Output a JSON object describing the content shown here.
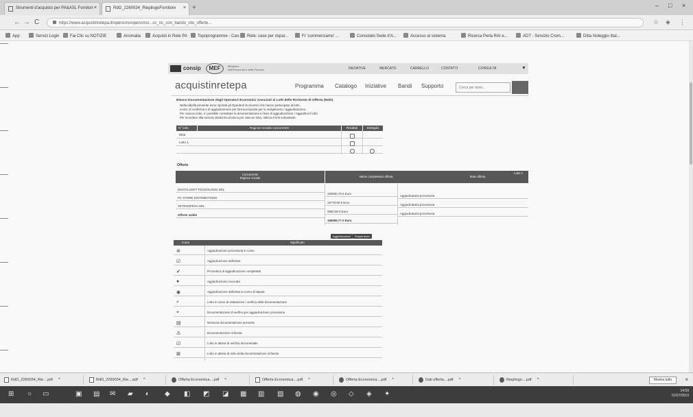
{
  "browser": {
    "tabs": [
      {
        "label": "Strumenti d'acquisto per PA&ASL Fornitori"
      },
      {
        "label": "RdO_2260034_RiepilogoFornitore"
      }
    ],
    "new_tab": "+",
    "window_controls": [
      "–",
      "□",
      "×"
    ],
    "nav": {
      "back": "←",
      "forward": "→",
      "reload": "C"
    },
    "url": "https://www.acquistinretepa.it/opencms/opencms/...cc_ric_con_bando_rdo_offerte...",
    "bookmarks": [
      "App",
      "Servizi Login",
      "Fai Clic su NOTIZIE",
      "Anomalia",
      "Acquisti in Rete PA",
      "Topoprogramme - Can...",
      "Rete: case per rispar...",
      "Fr 'commerciamo' ...",
      "Consolato Sede d'A...",
      "Accesso al sistema",
      "Ricerca Perla RAI e...",
      "ADT - Servizio Crom...",
      "Ditta Noleggio ittal..."
    ]
  },
  "site": {
    "consip": "consip",
    "mef": "MEF",
    "mef_subtitle": [
      "Ministero",
      "dell'Economia e delle Finanze"
    ],
    "topnav": [
      "INIZIATIVE",
      "MERCATO",
      "CARRELLO",
      "CONTATTI",
      "CONSULTA"
    ],
    "brand": "acquistinretepa",
    "mainnav": [
      "Programma",
      "Catalogo",
      "Iniziative",
      "Bandi",
      "Supporto"
    ],
    "search_placeholder": "Cerca per testo..."
  },
  "intro": {
    "title": "Elenco Documentazione degli Operatori Economici Associati ai Lotti delle Richieste di Offerta (RdO)",
    "lines": [
      "Nella tabella presente sono riportati gli Operatori Economici che hanno partecipato al lotto.",
      "Icona: di conferma e di aggiudicazione per forma proposta per lo svolgimento / aggiudicazione.",
      "Per ciascun lotto, e' possibile consultare la documentazione in fase di aggiudicazione / Aggiudica il lotto.",
      "Per accedere alla sezione Busta Economica per ciascun lotto, utilizza il link sottostante."
    ]
  },
  "table1": {
    "headers": [
      "N° lotto",
      "Ragione sociale concorrente",
      "Risultati",
      "Dettaglio"
    ],
    "rows": [
      {
        "lot": "",
        "name": "Ditta",
        "risultati": "",
        "dettaglio": ""
      },
      {
        "lot": "",
        "name": "Lotto 1",
        "risultati": "",
        "dettaglio": ""
      }
    ]
  },
  "offerte": {
    "label": "Offerte",
    "header_left": [
      "Concorrente",
      "Ragione sociale"
    ],
    "header_right": [
      "Lotto 1",
      "Valore complessivo offerta",
      "Stato offerta"
    ],
    "rows": [
      [
        "DIGITALSOFT TECNOLOGIE SRL",
        "150830,76 € Euro",
        "Aggiudicataria provvisoria"
      ],
      [
        "PC STORE DISTRIBUTIONS",
        "16770,60 € Euro",
        "Aggiudicataria provvisoria"
      ],
      [
        "VETROSPESA SRL",
        "3860,00 € Euro",
        "Aggiudicataria provvisoria"
      ],
      [
        "Offerte valide",
        "166089,77 € Euro",
        ""
      ]
    ],
    "buttons": [
      "Aggiudicazioni",
      "Sospensioni"
    ]
  },
  "legend": {
    "headers": [
      "Icona",
      "Significato"
    ],
    "rows": [
      {
        "icon": "⊛",
        "text": "Aggiudicazione provvisoria in corso"
      },
      {
        "icon": "☑",
        "text": "Aggiudicazione definitiva"
      },
      {
        "icon": "✔",
        "text": "Procedura di aggiudicazione completata"
      },
      {
        "icon": "●",
        "text": "Aggiudicazione revocata"
      },
      {
        "icon": "◉",
        "text": "Aggiudicazione definitiva in corso di stipula"
      },
      {
        "icon": "⌕",
        "text": "Lotto in corso di valutazione / verifica della documentazione"
      },
      {
        "icon": "⌖",
        "text": "Documentazione di verifica per aggiudicazione provvisoria"
      },
      {
        "icon": "▤",
        "text": "Nessuna documentazione presente"
      },
      {
        "icon": "♳",
        "text": "Documentazione richiesta"
      },
      {
        "icon": "☑",
        "text": "Lotto in attesa di verifica documentale"
      },
      {
        "icon": "⊠",
        "text": "Lotto in attesa di esito della documentazione richiesta"
      }
    ]
  },
  "downloads": {
    "items": [
      "RdO_2260034_Rie....pdf",
      "RdO_2260034_Rie....pdf",
      "Offerta Economica....pdf",
      "Offerta Economica....pdf",
      "Offerta Economica....pdf",
      "Dati offerta....pdf",
      "Riepilogo....pdf"
    ],
    "show_all": "Mostra tutto",
    "close": "×"
  },
  "taskbar": {
    "time": "14:59",
    "date": "01/07/2019"
  }
}
